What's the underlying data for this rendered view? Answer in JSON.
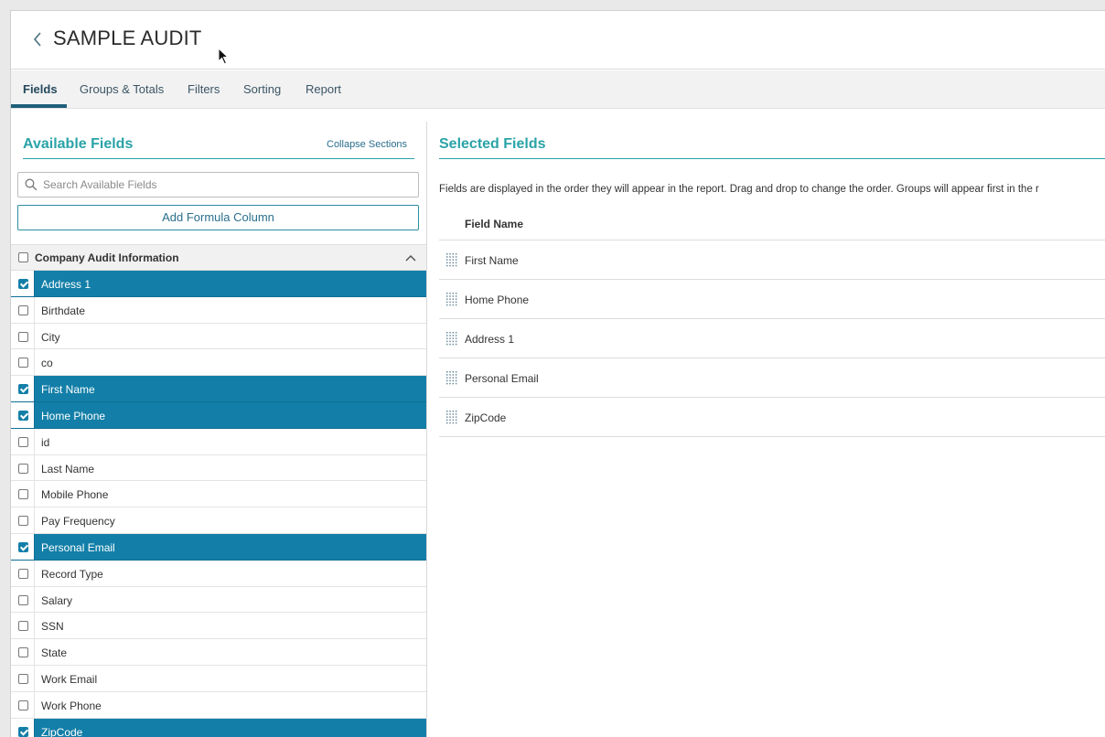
{
  "header": {
    "title": "SAMPLE AUDIT"
  },
  "tabs": [
    {
      "label": "Fields",
      "active": true
    },
    {
      "label": "Groups & Totals",
      "active": false
    },
    {
      "label": "Filters",
      "active": false
    },
    {
      "label": "Sorting",
      "active": false
    },
    {
      "label": "Report",
      "active": false
    }
  ],
  "available": {
    "title": "Available Fields",
    "collapse_label": "Collapse Sections",
    "search_placeholder": "Search Available Fields",
    "formula_button": "Add Formula Column",
    "section": {
      "label": "Company Audit Information",
      "checked": false
    },
    "items": [
      {
        "label": "Address 1",
        "checked": true
      },
      {
        "label": "Birthdate",
        "checked": false
      },
      {
        "label": "City",
        "checked": false
      },
      {
        "label": "co",
        "checked": false
      },
      {
        "label": "First Name",
        "checked": true
      },
      {
        "label": "Home Phone",
        "checked": true
      },
      {
        "label": "id",
        "checked": false
      },
      {
        "label": "Last Name",
        "checked": false
      },
      {
        "label": "Mobile Phone",
        "checked": false
      },
      {
        "label": "Pay Frequency",
        "checked": false
      },
      {
        "label": "Personal Email",
        "checked": true
      },
      {
        "label": "Record Type",
        "checked": false
      },
      {
        "label": "Salary",
        "checked": false
      },
      {
        "label": "SSN",
        "checked": false
      },
      {
        "label": "State",
        "checked": false
      },
      {
        "label": "Work Email",
        "checked": false
      },
      {
        "label": "Work Phone",
        "checked": false
      },
      {
        "label": "ZipCode",
        "checked": true
      }
    ]
  },
  "selected": {
    "title": "Selected Fields",
    "description": "Fields are displayed in the order they will appear in the report. Drag and drop to change the order. Groups will appear first in the r",
    "column_header": "Field Name",
    "items": [
      "First Name",
      "Home Phone",
      "Address 1",
      "Personal Email",
      "ZipCode"
    ]
  },
  "colors": {
    "accent": "#2aa3a8",
    "selected_row": "#137fa8",
    "tab_active": "#1e5f7a"
  }
}
